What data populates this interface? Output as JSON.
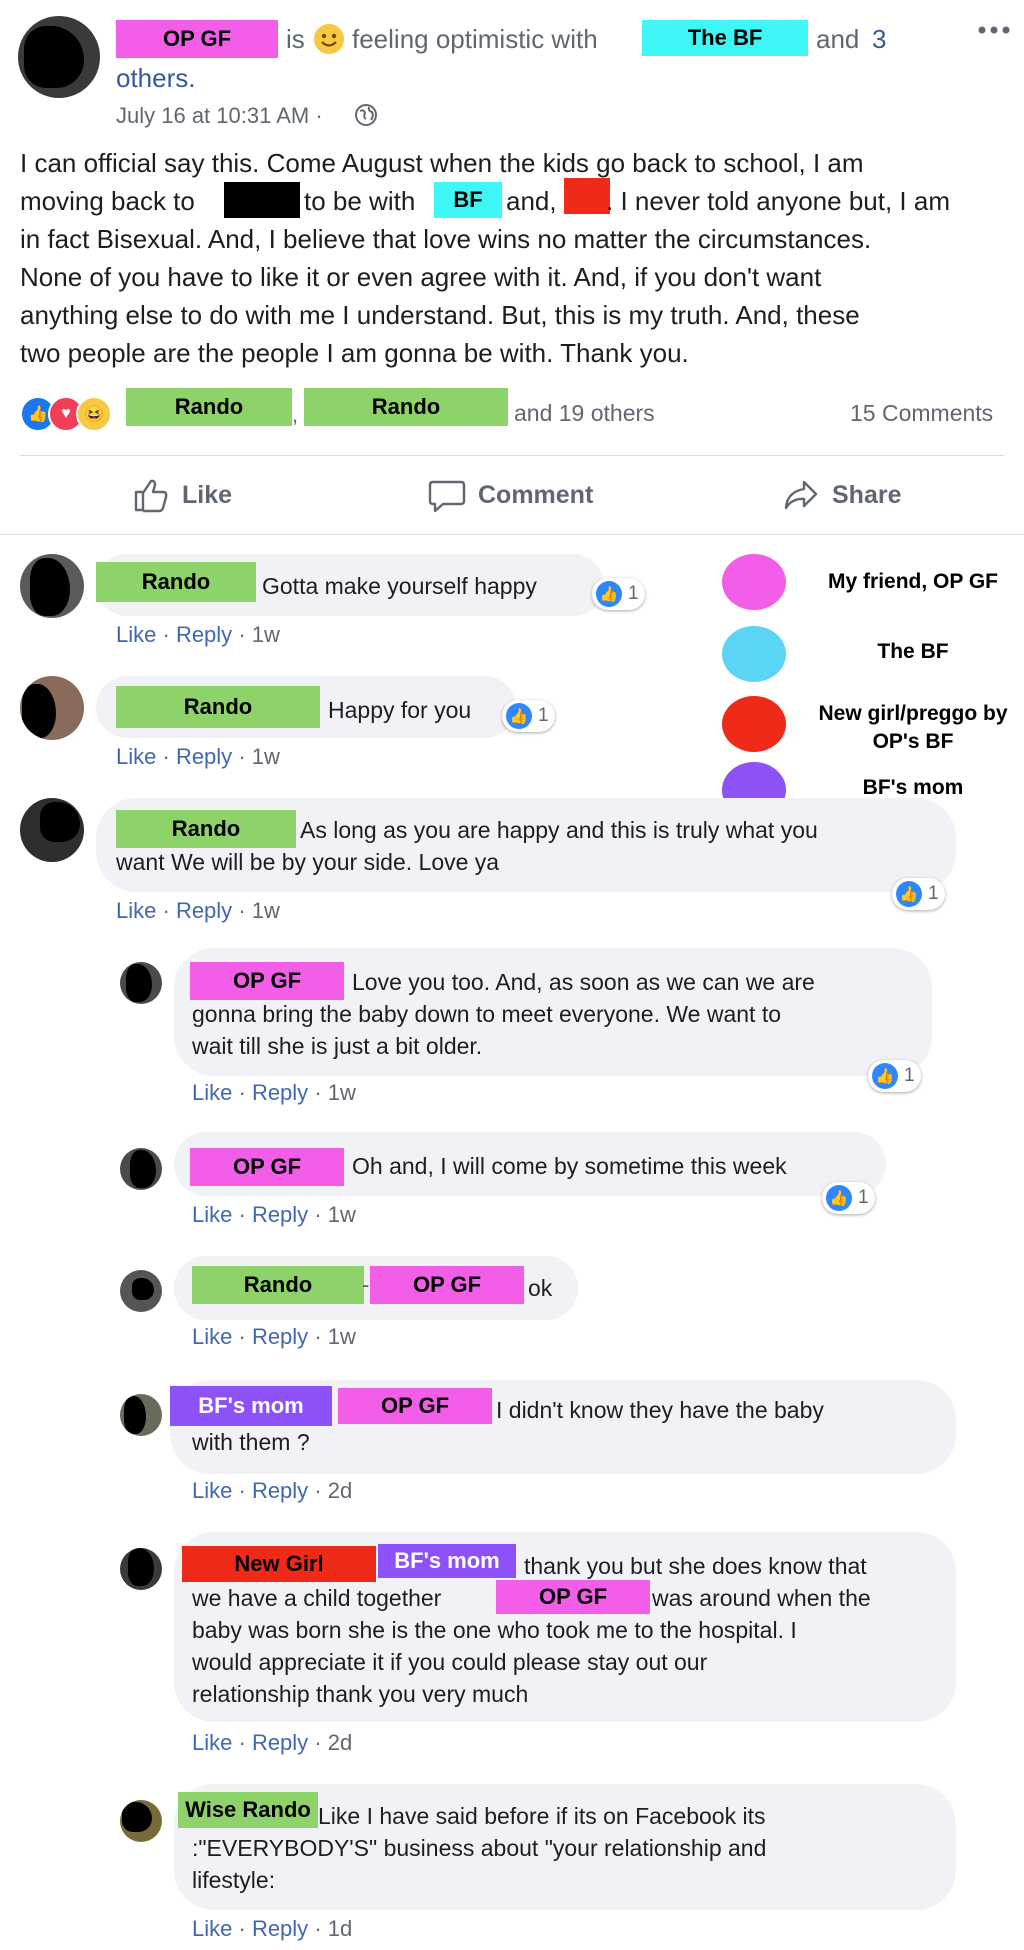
{
  "post": {
    "author_tag": "OP GF",
    "is_text": "is",
    "feeling_icon": "smiley-face-icon",
    "feeling_text": "feeling optimistic with",
    "with_tag": "The BF",
    "and_text": "and",
    "others_link": "3",
    "others_word": "others.",
    "timestamp": "July 16 at 10:31 AM ·",
    "privacy_icon": "globe-icon",
    "more_icon": "more-options-icon",
    "body": {
      "l1": "I can official say this. Come August when the kids go back to school, I am",
      "l2a": "moving back to",
      "l2b": "to be with",
      "l2_tag": "BF",
      "l2c": "and,",
      "l2d": ". I never told anyone but, I am",
      "l3": "in fact Bisexual. And, I believe that love wins no matter the circumstances.",
      "l4": "None of you have to like it or even agree with it. And, if you don't want",
      "l5": "anything else to do with me I understand. But, this is my truth. And, these",
      "l6": "two people are the people I am gonna be with. Thank you."
    },
    "reactions": {
      "names": [
        "Rando",
        "Rando"
      ],
      "comma": ",",
      "others": "and 19 others",
      "comments_count": "15 Comments"
    },
    "actions": {
      "like": "Like",
      "comment": "Comment",
      "share": "Share"
    }
  },
  "legend": [
    {
      "label": "My friend, OP GF",
      "color": "#f35ee8"
    },
    {
      "label": "The BF",
      "color": "#5bd5f5"
    },
    {
      "label": "New girl/preggo by OP's BF",
      "color": "#f02a18"
    },
    {
      "label": "BF's mom",
      "color": "#8c52f7"
    }
  ],
  "comments": [
    {
      "tag": "Rando",
      "text": "Gotta make yourself happy",
      "likes": "1",
      "meta_like": "Like",
      "meta_reply": "Reply",
      "meta_time": "· 1w"
    },
    {
      "tag": "Rando",
      "text": "Happy for you",
      "likes": "1",
      "meta_like": "Like",
      "meta_reply": "Reply",
      "meta_time": "· 1w"
    },
    {
      "tag": "Rando",
      "text1": "As long as you are happy and this is truly what you",
      "text2": "want We will be by your side. Love ya",
      "likes": "1",
      "meta_like": "Like",
      "meta_reply": "Reply",
      "meta_time": "· 1w"
    }
  ],
  "replies": [
    {
      "tag": "OP GF",
      "text1": "Love you too. And, as soon as we can we are",
      "text2": "gonna bring the baby down to meet everyone. We want to",
      "text3": "wait till she is just a bit older.",
      "likes": "1",
      "meta_time": "· 1w"
    },
    {
      "tag": "OP GF",
      "text1": "Oh and, I will come by sometime this week",
      "likes": "1",
      "meta_time": "· 1w"
    },
    {
      "tag1": "Rando",
      "dash": "-",
      "tag2": "OP GF",
      "text1": "ok",
      "meta_time": "· 1w"
    },
    {
      "tag1": "BF's mom",
      "tag2": "OP GF",
      "text1": "I didn't know they have the baby",
      "text2": "with them ?",
      "meta_time": "· 2d"
    },
    {
      "tag1": "New Girl",
      "tag2": "BF's mom",
      "text1": "thank you but she does know that",
      "text2a": "we have a child together",
      "tag3": "OP GF",
      "text2b": "was around when the",
      "text3": "baby was born she is the one who took me to the hospital. I",
      "text4": "would appreciate it if you could please stay out our",
      "text5": "relationship thank you very much",
      "meta_time": "· 2d"
    },
    {
      "tag": "Wise Rando",
      "text1": "Like I have said before if its on Facebook its",
      "text2": ":\"EVERYBODY'S\" business about \"your relationship and",
      "text3": "lifestyle:",
      "meta_time": "· 1d"
    }
  ],
  "meta_common": {
    "like": "Like",
    "sep": "·",
    "reply": "Reply"
  }
}
